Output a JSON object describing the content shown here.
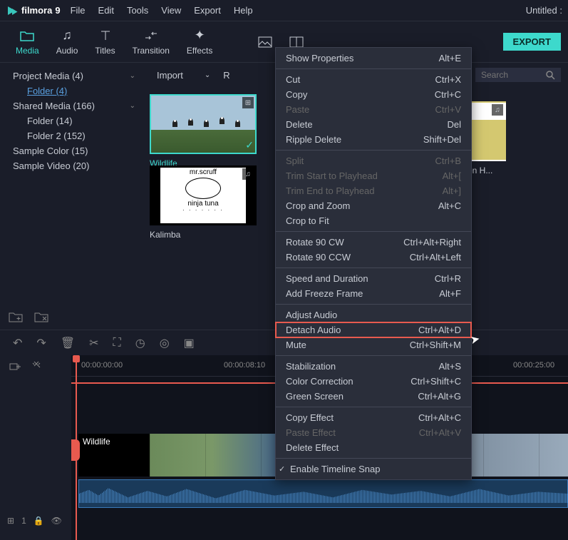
{
  "app": {
    "name": "filmora",
    "version": "9",
    "title": "Untitled :"
  },
  "menubar": [
    "File",
    "Edit",
    "Tools",
    "View",
    "Export",
    "Help"
  ],
  "toolbar": {
    "items": [
      {
        "label": "Media",
        "icon": "folder"
      },
      {
        "label": "Audio",
        "icon": "note"
      },
      {
        "label": "Titles",
        "icon": "text"
      },
      {
        "label": "Transition",
        "icon": "swap"
      },
      {
        "label": "Effects",
        "icon": "sparkle"
      },
      {
        "label": "",
        "icon": "image"
      },
      {
        "label": "",
        "icon": "layout"
      }
    ],
    "export": "EXPORT"
  },
  "sidebar": {
    "items": [
      {
        "label": "Project Media (4)",
        "level": 1,
        "arrow": true
      },
      {
        "label": "Folder (4)",
        "level": 2,
        "selected": true
      },
      {
        "label": "Shared Media (166)",
        "level": 1,
        "arrow": true
      },
      {
        "label": "Folder (14)",
        "level": 2
      },
      {
        "label": "Folder 2 (152)",
        "level": 2
      },
      {
        "label": "Sample Color (15)",
        "level": 1
      },
      {
        "label": "Sample Video (20)",
        "level": 1
      }
    ]
  },
  "content_top": {
    "import": "Import",
    "record": "R",
    "search_placeholder": "Search"
  },
  "media": [
    {
      "name": "Wildlife",
      "selected": true,
      "video": true,
      "checked": true
    },
    {
      "name": "Kalimba",
      "audio": true
    },
    {
      "name": "xen H...",
      "audio": true,
      "trimmed": true
    }
  ],
  "timeline": {
    "ticks": [
      "00:00:00:00",
      "00:00:08:10",
      "00:00:25:00"
    ],
    "track_label": "Wildlife",
    "track_info": "1"
  },
  "context_menu": {
    "groups": [
      [
        {
          "label": "Show Properties",
          "shortcut": "Alt+E"
        }
      ],
      [
        {
          "label": "Cut",
          "shortcut": "Ctrl+X"
        },
        {
          "label": "Copy",
          "shortcut": "Ctrl+C"
        },
        {
          "label": "Paste",
          "shortcut": "Ctrl+V",
          "disabled": true
        },
        {
          "label": "Delete",
          "shortcut": "Del"
        },
        {
          "label": "Ripple Delete",
          "shortcut": "Shift+Del"
        }
      ],
      [
        {
          "label": "Split",
          "shortcut": "Ctrl+B",
          "disabled": true
        },
        {
          "label": "Trim Start to Playhead",
          "shortcut": "Alt+[",
          "disabled": true
        },
        {
          "label": "Trim End to Playhead",
          "shortcut": "Alt+]",
          "disabled": true
        },
        {
          "label": "Crop and Zoom",
          "shortcut": "Alt+C"
        },
        {
          "label": "Crop to Fit",
          "shortcut": ""
        }
      ],
      [
        {
          "label": "Rotate 90 CW",
          "shortcut": "Ctrl+Alt+Right"
        },
        {
          "label": "Rotate 90 CCW",
          "shortcut": "Ctrl+Alt+Left"
        }
      ],
      [
        {
          "label": "Speed and Duration",
          "shortcut": "Ctrl+R"
        },
        {
          "label": "Add Freeze Frame",
          "shortcut": "Alt+F"
        }
      ],
      [
        {
          "label": "Adjust Audio",
          "shortcut": ""
        },
        {
          "label": "Detach Audio",
          "shortcut": "Ctrl+Alt+D",
          "highlight": true
        },
        {
          "label": "Mute",
          "shortcut": "Ctrl+Shift+M"
        }
      ],
      [
        {
          "label": "Stabilization",
          "shortcut": "Alt+S"
        },
        {
          "label": "Color Correction",
          "shortcut": "Ctrl+Shift+C"
        },
        {
          "label": "Green Screen",
          "shortcut": "Ctrl+Alt+G"
        }
      ],
      [
        {
          "label": "Copy Effect",
          "shortcut": "Ctrl+Alt+C"
        },
        {
          "label": "Paste Effect",
          "shortcut": "Ctrl+Alt+V",
          "disabled": true
        },
        {
          "label": "Delete Effect",
          "shortcut": ""
        }
      ],
      [
        {
          "label": "Enable Timeline Snap",
          "shortcut": "",
          "checked": true
        }
      ]
    ]
  }
}
